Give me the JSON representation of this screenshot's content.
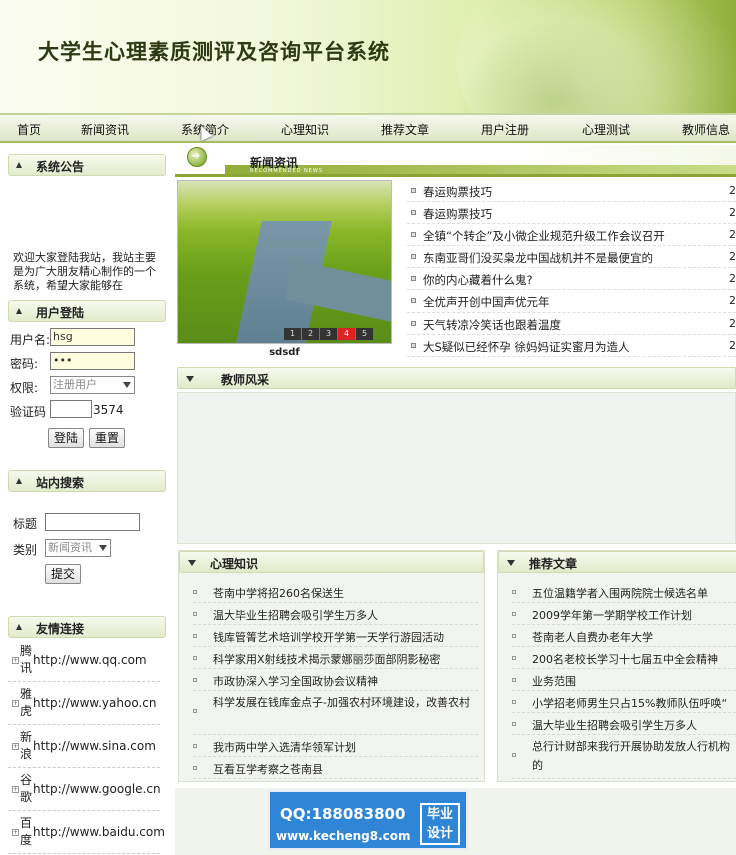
{
  "header": {
    "title": "大学生心理素质测评及咨询平台系统"
  },
  "nav": [
    "首页",
    "新闻资讯",
    "系统简介",
    "心理知识",
    "推荐文章",
    "用户注册",
    "心理测试",
    "教师信息"
  ],
  "sidebar": {
    "notice_title": "系统公告",
    "notice_text": "欢迎大家登陆我站，我站主要是为广大朋友精心制作的一个系统，希望大家能够在",
    "login_title": "用户登陆",
    "username_label": "用户名:",
    "username_value": "hsg",
    "password_label": "密码:",
    "password_value": "•••",
    "role_label": "权限:",
    "role_value": "注册用户",
    "captcha_label": "验证码",
    "captcha_value": "3574",
    "login_button": "登陆",
    "reset_button": "重置",
    "search_title": "站内搜索",
    "search_title_label": "标题",
    "search_type_label": "类别",
    "search_type_value": "新闻资讯",
    "search_button": "提交",
    "links_title": "友情连接",
    "links": [
      {
        "name": "腾讯",
        "url": "http://www.qq.com"
      },
      {
        "name": "雅虎",
        "url": "http://www.yahoo.cn"
      },
      {
        "name": "新浪",
        "url": "http://www.sina.com"
      },
      {
        "name": "谷歌",
        "url": "http://www.google.cn"
      },
      {
        "name": "百度",
        "url": "http://www.baidu.com"
      }
    ]
  },
  "news": {
    "title": "新闻资讯",
    "subtitle": "RECOMMENDED NEWS",
    "photo_caption": "sdsdf",
    "photo_pages": [
      "1",
      "2",
      "3",
      "4",
      "5"
    ],
    "items": [
      {
        "title": "春运购票技巧",
        "date": "2"
      },
      {
        "title": "春运购票技巧",
        "date": "2"
      },
      {
        "title": "全镇“个转企”及小微企业规范升级工作会议召开",
        "date": "2"
      },
      {
        "title": "东南亚哥们没买枭龙中国战机并不是最便宜的",
        "date": "2"
      },
      {
        "title": "你的内心藏着什么鬼?",
        "date": "2"
      },
      {
        "title": "全优声开创中国声优元年",
        "date": "2"
      },
      {
        "title": "天气转凉冷笑话也跟着温度",
        "date": "2"
      },
      {
        "title": "大S疑似已经怀孕 徐妈妈证实蜜月为造人",
        "date": "2"
      }
    ]
  },
  "teachers": {
    "title": "教师风采"
  },
  "knowledge": {
    "title": "心理知识",
    "items": [
      "苍南中学将招260名保送生",
      "温大毕业生招聘会吸引学生万多人",
      "钱库管箐艺术培训学校开学第一天学行游园活动",
      "科学家用X射线技术揭示蒙娜丽莎面部阴影秘密",
      "市政协深入学习全国政协会议精神",
      "科学发展在钱库金点子-加强农村环境建设，改善农村",
      "我市两中学入选清华领军计划",
      "互看互学考察之苍南县"
    ]
  },
  "recommend": {
    "title": "推荐文章",
    "items": [
      "五位温籍学者入围两院院士候选名单",
      "2009学年第一学期学校工作计划",
      "苍南老人自费办老年大学",
      "200名老校长学习十七届五中全会精神",
      "业务范围",
      "小学招老师男生只占15%教师队伍呼唤“",
      "温大毕业生招聘会吸引学生万多人",
      "总行计财部来我行开展协助发放人行机构的"
    ]
  },
  "watermark": {
    "qq": "QQ:188083800",
    "site": "www.kecheng8.com",
    "tag1": "毕业",
    "tag2": "设计"
  }
}
